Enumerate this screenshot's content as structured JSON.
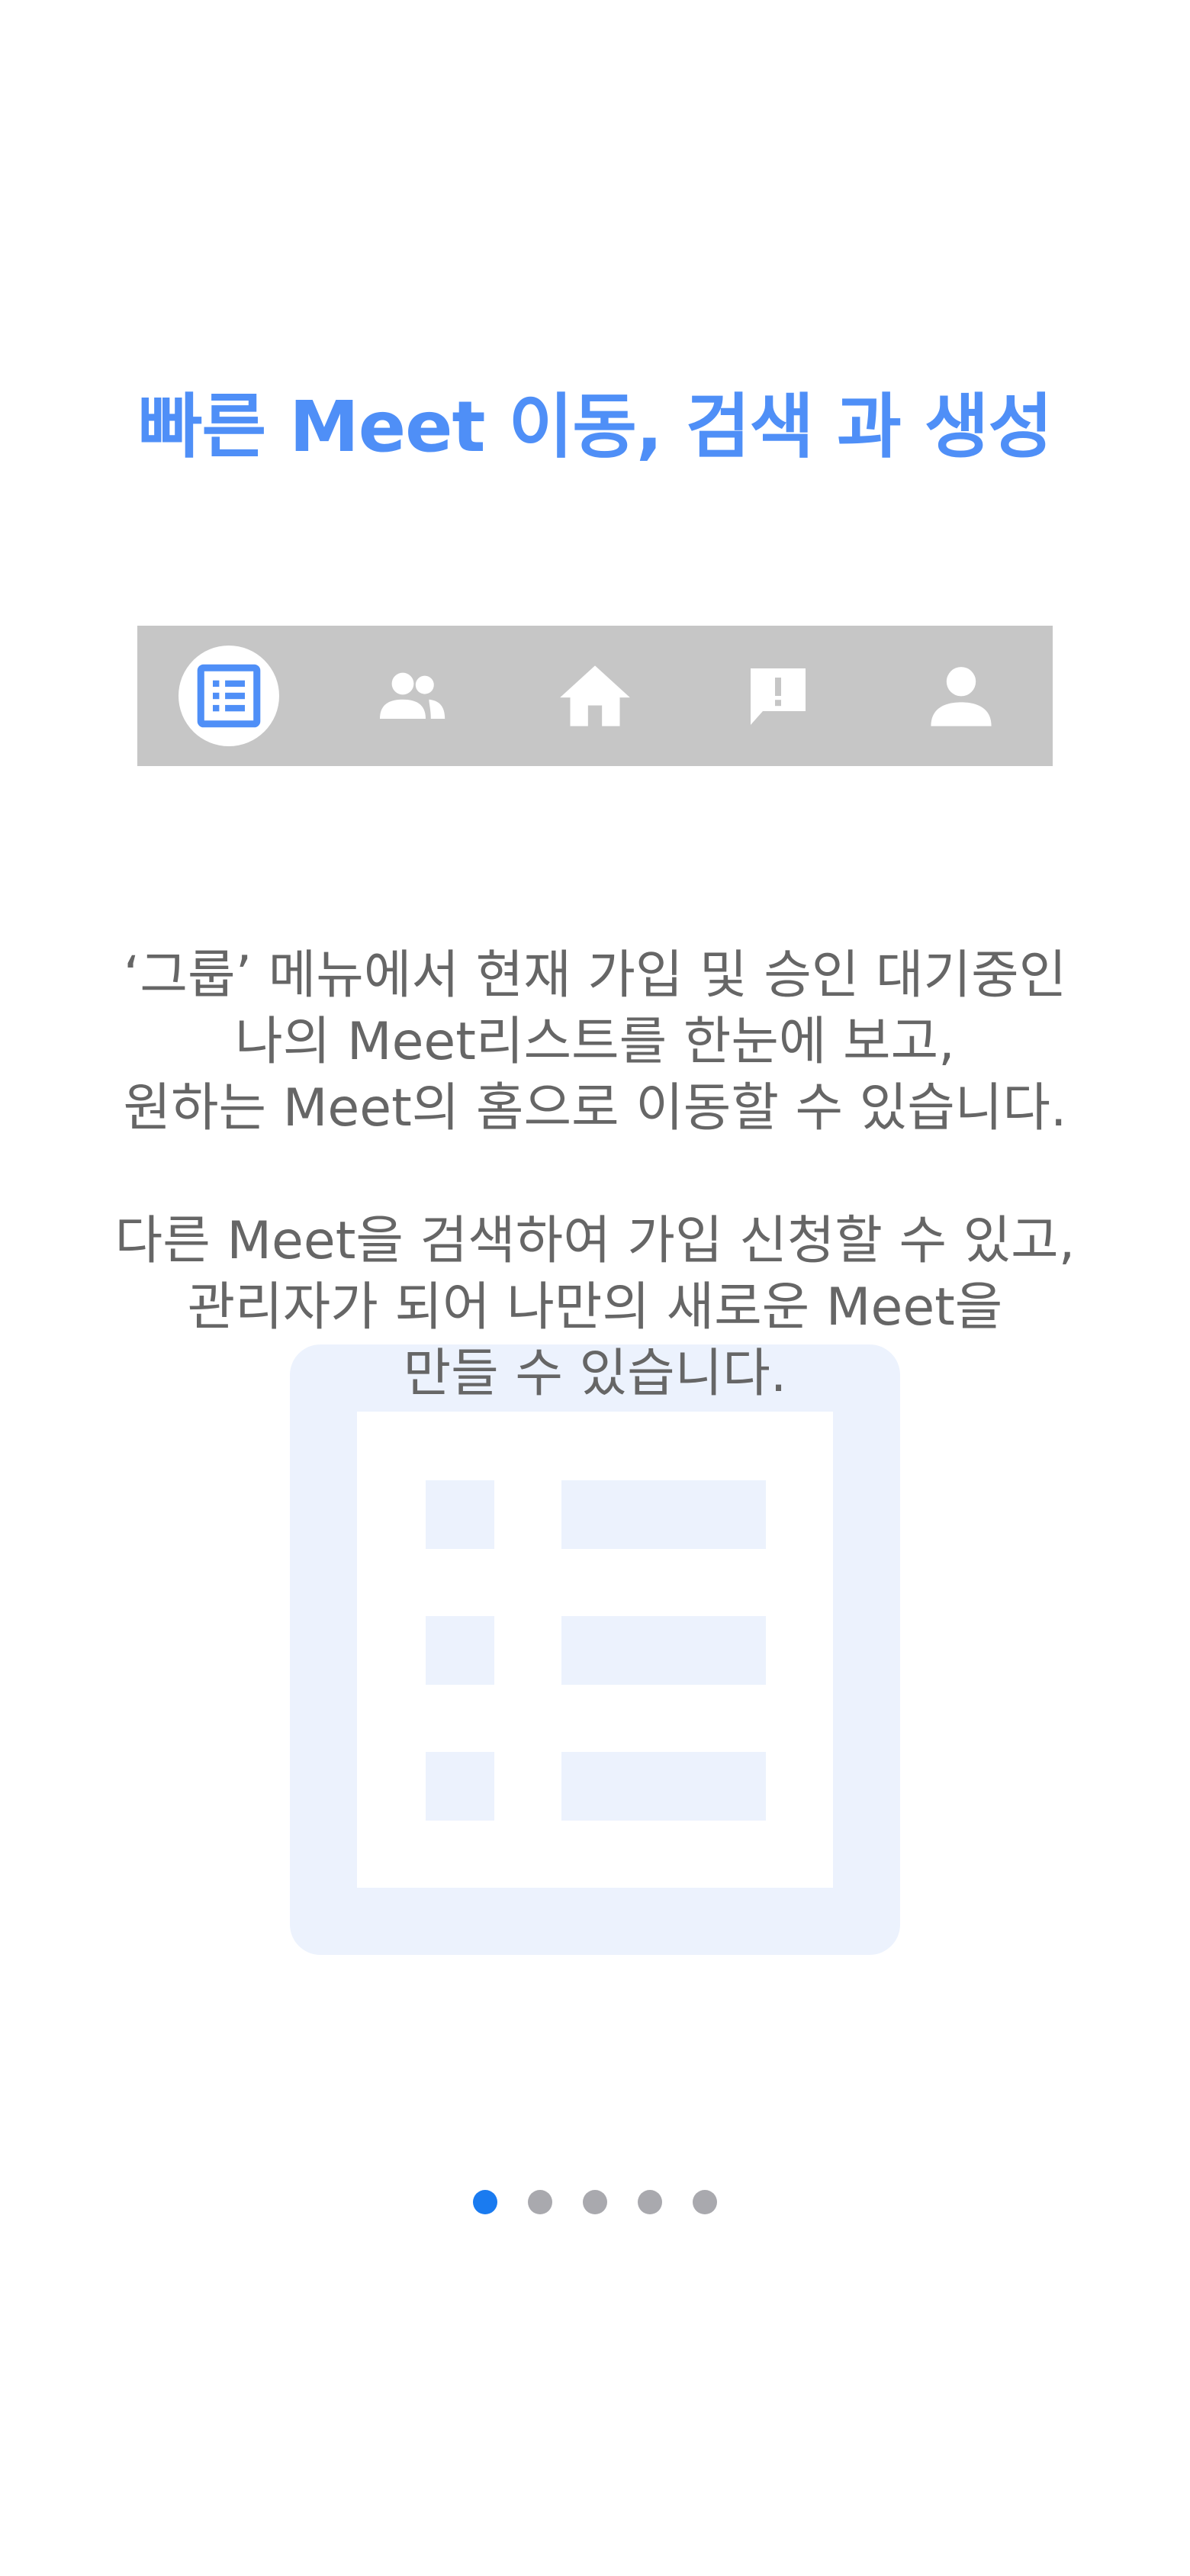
{
  "title": "빠른 Meet 이동, 검색 과 생성",
  "tabbar": {
    "tabs": [
      {
        "icon": "list-icon",
        "selected": true
      },
      {
        "icon": "group-icon",
        "selected": false
      },
      {
        "icon": "home-icon",
        "selected": false
      },
      {
        "icon": "report-icon",
        "selected": false
      },
      {
        "icon": "person-icon",
        "selected": false
      }
    ]
  },
  "description": {
    "paragraph1": [
      "‘그룹’ 메뉴에서 현재 가입 및 승인 대기중인",
      "나의 Meet리스트를 한눈에 보고,",
      "원하는 Meet의 홈으로 이동할 수 있습니다."
    ],
    "paragraph2": [
      "다른 Meet을 검색하여 가입 신청할 수 있고,",
      "관리자가 되어 나만의 새로운 Meet을",
      "만들 수 있습니다."
    ]
  },
  "pagination": {
    "total": 5,
    "current": 1
  },
  "colors": {
    "accent": "#4f8ff7",
    "tabbar_bg": "#c6c6c6",
    "text": "#666666",
    "dot_active": "#1a7bf0",
    "dot_inactive": "#a9a9ae",
    "watermark": "#ecf2fd"
  }
}
